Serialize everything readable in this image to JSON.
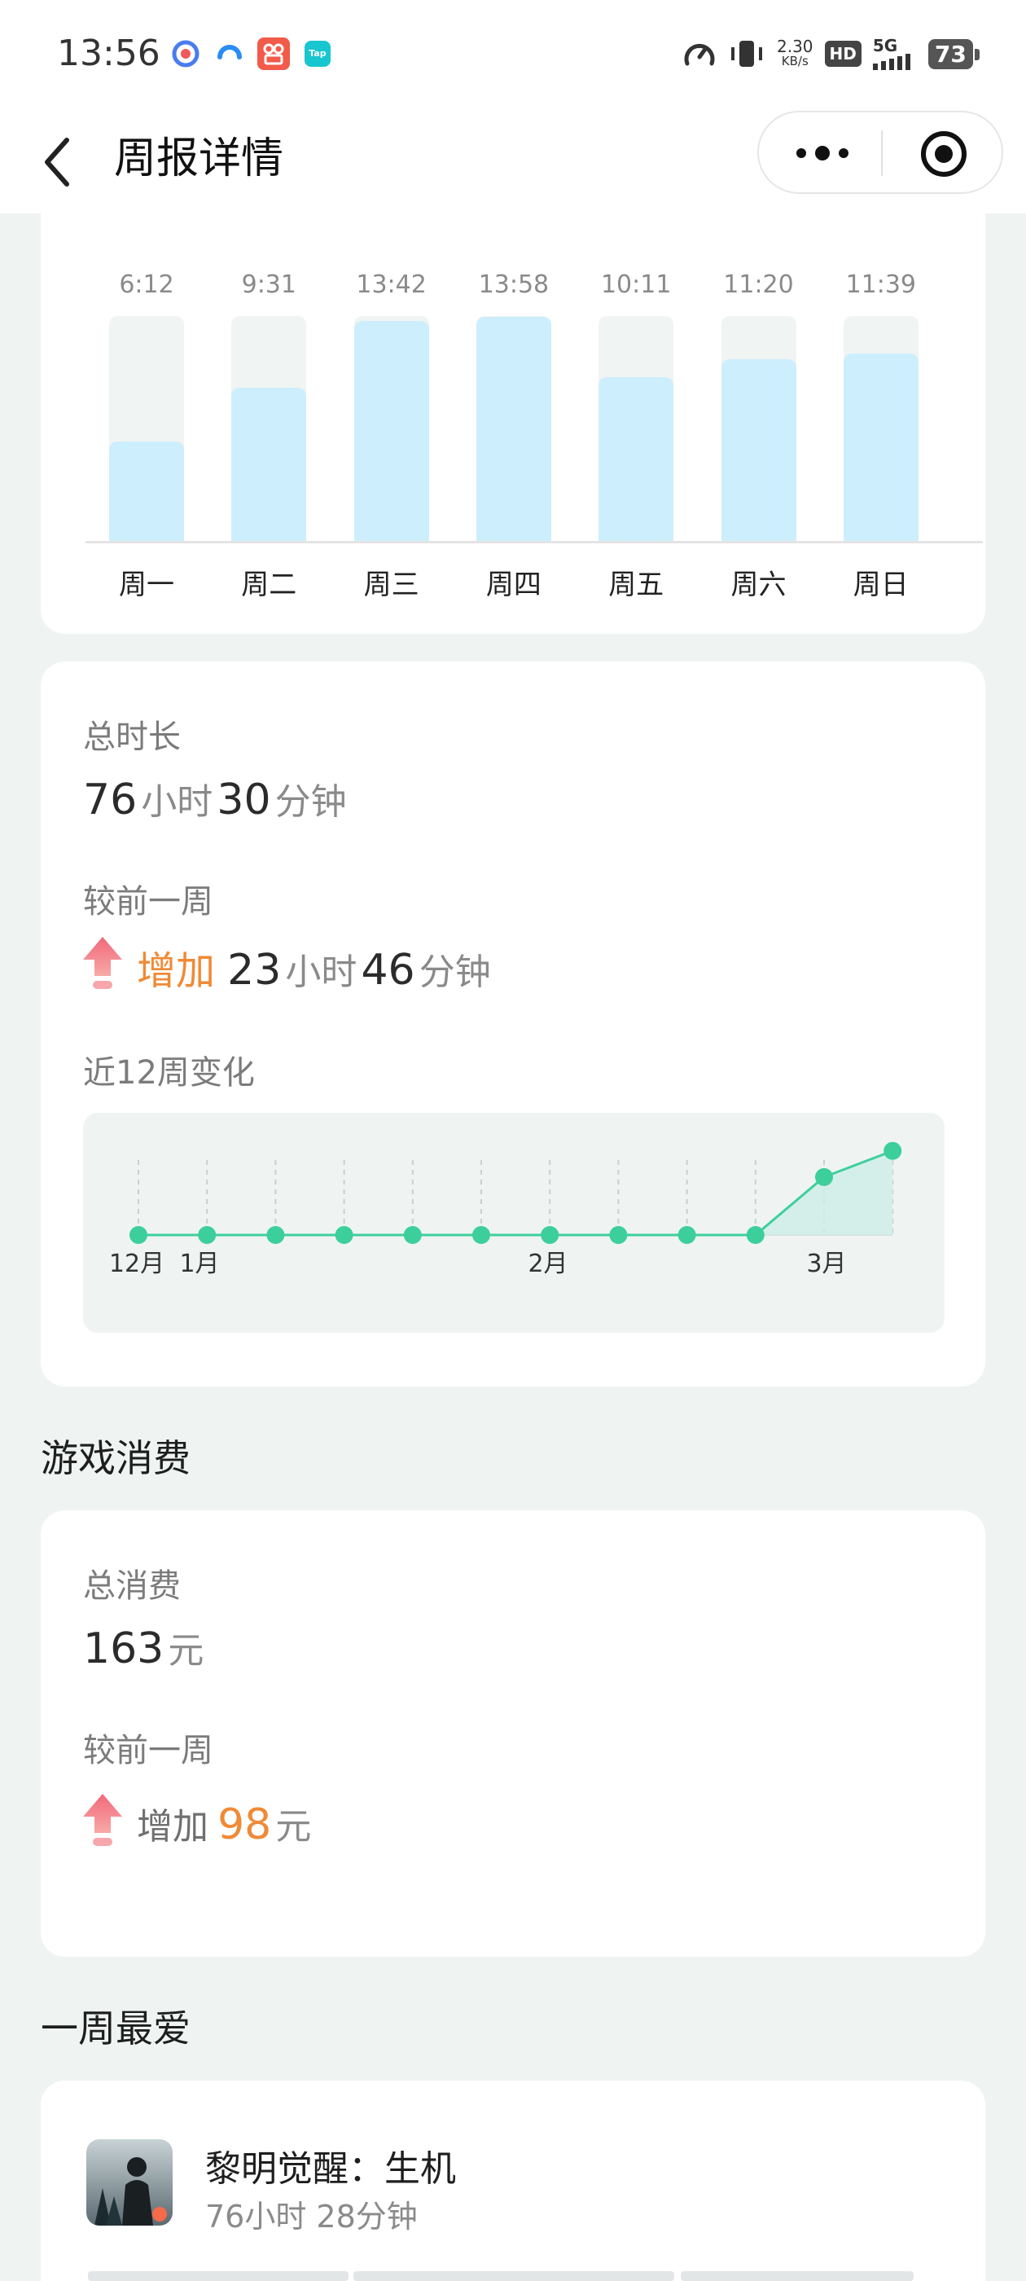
{
  "status_bar": {
    "time": "13:56",
    "net_speed_value": "2.30",
    "net_speed_unit": "KB/s",
    "hd": "HD",
    "network": "5G",
    "battery": "73",
    "app_icons": [
      "weather-app-icon",
      "browser-app-icon",
      "video-app-icon",
      "taptap-app-icon"
    ],
    "app_icon_text": "Tap"
  },
  "nav": {
    "title": "周报详情",
    "back_icon": "chevron-left-icon",
    "more_icon": "more-dots-icon",
    "close_icon": "target-circle-icon"
  },
  "daily_chart": {
    "chart_data": {
      "type": "bar",
      "categories": [
        "周一",
        "周二",
        "周三",
        "周四",
        "周五",
        "周六",
        "周日"
      ],
      "labels": [
        "6:12",
        "9:31",
        "13:42",
        "13:58",
        "10:11",
        "11:20",
        "11:39"
      ],
      "values_minutes": [
        372,
        571,
        822,
        838,
        611,
        680,
        699
      ]
    }
  },
  "duration": {
    "total_label": "总时长",
    "hours": "76",
    "hours_unit": "小时",
    "minutes": "30",
    "minutes_unit": "分钟",
    "compare_label": "较前一周",
    "change_word": "增加",
    "change_hours": "23",
    "change_hours_unit": "小时",
    "change_minutes": "46",
    "change_minutes_unit": "分钟",
    "trend_label": "近12周变化"
  },
  "trend_chart": {
    "chart_data": {
      "type": "line",
      "x_tick_labels": [
        "12月",
        "1月",
        "2月",
        "3月"
      ],
      "points": 12,
      "values_hours": [
        0,
        0,
        0,
        0,
        0,
        0,
        0,
        0,
        0,
        0,
        52.7,
        76.5
      ]
    }
  },
  "spending": {
    "section_title": "游戏消费",
    "total_label": "总消费",
    "amount": "163",
    "amount_unit": "元",
    "compare_label": "较前一周",
    "change_word": "增加",
    "change_amount": "98",
    "change_unit": "元"
  },
  "favorite": {
    "section_title": "一周最爱",
    "game_name": "黎明觉醒：生机",
    "game_time": "76小时 28分钟"
  },
  "colors": {
    "accent_orange": "#f08a36",
    "bar_fill": "#cdeefc",
    "trend_line": "#3ccf9c",
    "up_arrow": "#f0697a"
  }
}
